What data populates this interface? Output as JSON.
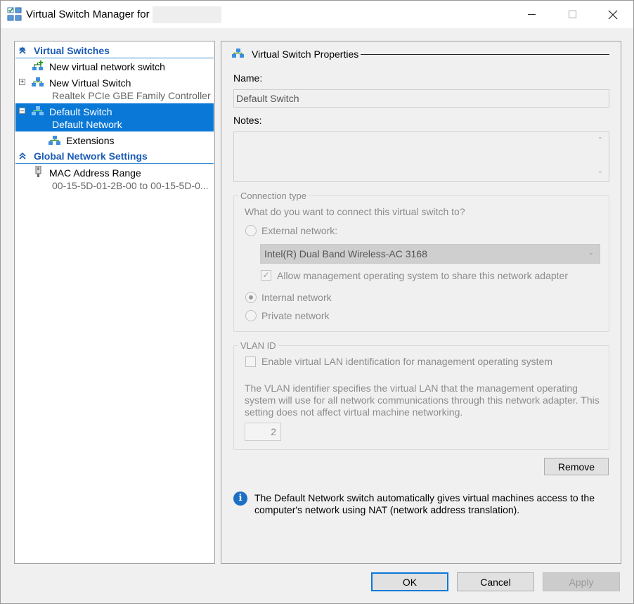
{
  "window": {
    "title": "Virtual Switch Manager for"
  },
  "tree": {
    "virtual_switches_header": "Virtual Switches",
    "new_switch": "New virtual network switch",
    "item1_name": "New Virtual Switch",
    "item1_sub": "Realtek PCIe GBE Family Controller",
    "item2_name": "Default Switch",
    "item2_sub": "Default Network",
    "extensions": "Extensions",
    "global_header": "Global Network Settings",
    "mac_name": "MAC Address Range",
    "mac_sub": "00-15-5D-01-2B-00 to 00-15-5D-0..."
  },
  "props": {
    "section_title": "Virtual Switch Properties",
    "name_label": "Name:",
    "name_value": "Default Switch",
    "notes_label": "Notes:",
    "connection_type": {
      "title": "Connection type",
      "question": "What do you want to connect this virtual switch to?",
      "external": "External network:",
      "adapter": "Intel(R) Dual Band Wireless-AC 3168",
      "allow_mgmt": "Allow management operating system to share this network adapter",
      "internal": "Internal network",
      "private": "Private network",
      "selected": "internal"
    },
    "vlan": {
      "title": "VLAN ID",
      "enable": "Enable virtual LAN identification for management operating system",
      "description": "The VLAN identifier specifies the virtual LAN that the management operating system will use for all network communications through this network adapter. This setting does not affect virtual machine networking.",
      "desc_line1": "The VLAN identifier specifies the virtual LAN that the management operating",
      "desc_line2": "system will use for all network communications through this network adapter. This",
      "desc_line3": "setting does not affect virtual machine networking.",
      "value": "2"
    },
    "remove": "Remove",
    "info_line1": "The Default Network switch automatically gives virtual machines access to the",
    "info_line2": "computer's network using NAT (network address translation)."
  },
  "footer": {
    "ok": "OK",
    "cancel": "Cancel",
    "apply": "Apply"
  }
}
